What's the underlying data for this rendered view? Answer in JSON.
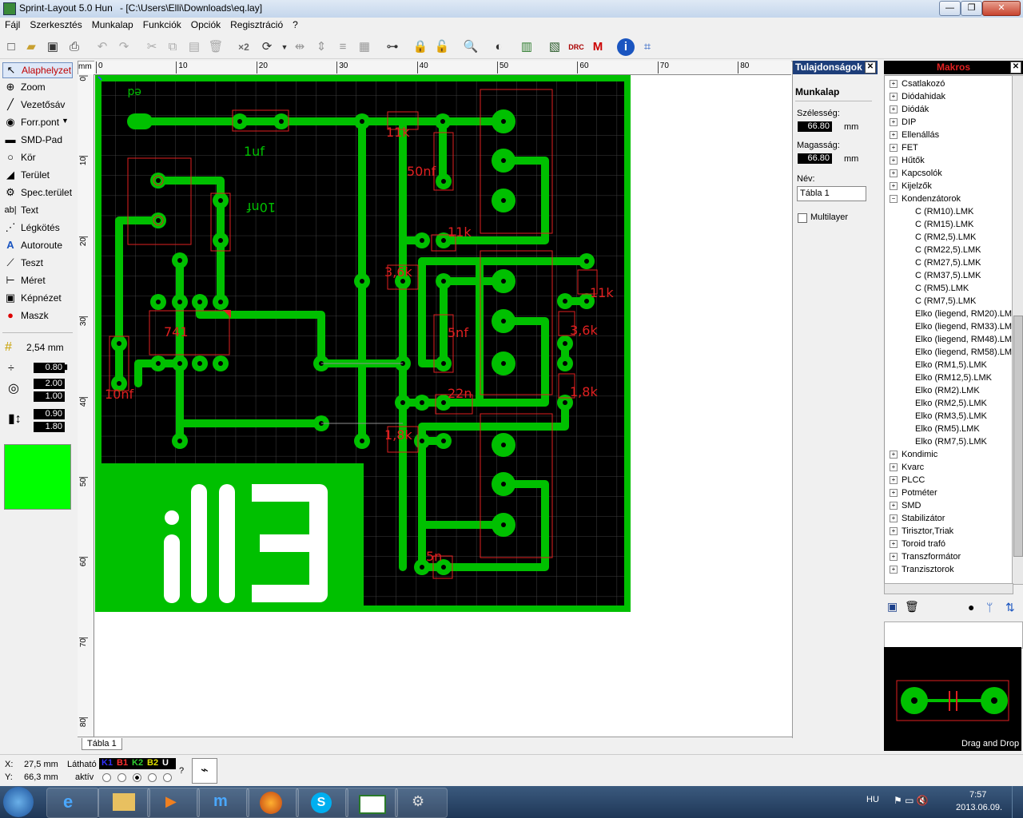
{
  "window": {
    "app_title": "Sprint-Layout 5.0 Hun",
    "file_path": "- [C:\\Users\\Elli\\Downloads\\eq.lay]",
    "minimize": "—",
    "restore": "❐",
    "close": "✕"
  },
  "menu": [
    "Fájl",
    "Szerkesztés",
    "Munkalap",
    "Funkciók",
    "Opciók",
    "Regisztráció",
    "?"
  ],
  "toolbar": {
    "x2_label": "×2"
  },
  "tools": [
    {
      "label": "Alaphelyzet",
      "icon": "pointer-icon"
    },
    {
      "label": "Zoom",
      "icon": "zoom-icon"
    },
    {
      "label": "Vezetősáv",
      "icon": "track-icon"
    },
    {
      "label": "Forr.pont",
      "icon": "pad-icon"
    },
    {
      "label": "SMD-Pad",
      "icon": "smd-pad-icon"
    },
    {
      "label": "Kör",
      "icon": "circle-icon"
    },
    {
      "label": "Terület",
      "icon": "zone-icon"
    },
    {
      "label": "Spec.terület",
      "icon": "special-zone-icon"
    },
    {
      "label": "Text",
      "icon": "text-icon"
    },
    {
      "label": "Légkötés",
      "icon": "airwire-icon"
    },
    {
      "label": "Autoroute",
      "icon": "autoroute-icon"
    },
    {
      "label": "Teszt",
      "icon": "test-icon"
    },
    {
      "label": "Méret",
      "icon": "measure-icon"
    },
    {
      "label": "Képnézet",
      "icon": "photoview-icon"
    },
    {
      "label": "Maszk",
      "icon": "mask-icon"
    }
  ],
  "grid": {
    "label": "2,54 mm"
  },
  "settings": {
    "track_width": "0.80",
    "pad_outer": "2.00",
    "pad_inner": "1.00",
    "smd_w": "0.90",
    "smd_h": "1.80"
  },
  "colors": {
    "active_layer": "#00ff00",
    "board": "#000000",
    "copper": "#00cc00",
    "component": "#ff2020"
  },
  "ruler": {
    "top_unit": "mm",
    "top": [
      "0",
      "10",
      "20",
      "30",
      "40",
      "50",
      "60",
      "70",
      "80"
    ],
    "left": [
      "0",
      "10",
      "20",
      "30",
      "40",
      "50",
      "60",
      "70",
      "80"
    ]
  },
  "board": {
    "labels": [
      "ed",
      "1uf",
      "10nf",
      "741",
      "10nf",
      "11k",
      "50nf",
      "11k",
      "3,6k",
      "5nf",
      "22n",
      "1,8k",
      "5n",
      "11k",
      "3,6k",
      "1,8k"
    ],
    "logo": "ill3"
  },
  "sheet_tab": "Tábla 1",
  "properties": {
    "header": "Tulajdonságok",
    "section": "Munkalap",
    "width_label": "Szélesség:",
    "width_value": "66.80",
    "height_label": "Magasság:",
    "height_value": "66.80",
    "unit": "mm",
    "name_label": "Név:",
    "name_value": "Tábla 1",
    "multilayer": "Multilayer"
  },
  "macros": {
    "header": "Makros",
    "items": [
      {
        "label": "Csatlakozó",
        "level": 0
      },
      {
        "label": "Diódahidak",
        "level": 0
      },
      {
        "label": "Diódák",
        "level": 0
      },
      {
        "label": "DIP",
        "level": 0
      },
      {
        "label": "Ellenállás",
        "level": 0
      },
      {
        "label": "FET",
        "level": 0
      },
      {
        "label": "Hűtők",
        "level": 0
      },
      {
        "label": "Kapcsolók",
        "level": 0
      },
      {
        "label": "Kijelzők",
        "level": 0
      },
      {
        "label": "Kondenzátorok",
        "level": 0,
        "open": true
      },
      {
        "label": "C (RM10).LMK",
        "level": 1
      },
      {
        "label": "C (RM15).LMK",
        "level": 1
      },
      {
        "label": "C (RM2,5).LMK",
        "level": 1
      },
      {
        "label": "C (RM22,5).LMK",
        "level": 1
      },
      {
        "label": "C (RM27,5).LMK",
        "level": 1
      },
      {
        "label": "C (RM37,5).LMK",
        "level": 1
      },
      {
        "label": "C (RM5).LMK",
        "level": 1
      },
      {
        "label": "C (RM7,5).LMK",
        "level": 1
      },
      {
        "label": "Elko (liegend, RM20).LM",
        "level": 1
      },
      {
        "label": "Elko (liegend, RM33).LM",
        "level": 1
      },
      {
        "label": "Elko (liegend, RM48).LM",
        "level": 1
      },
      {
        "label": "Elko (liegend, RM58).LM",
        "level": 1
      },
      {
        "label": "Elko (RM1,5).LMK",
        "level": 1
      },
      {
        "label": "Elko (RM12,5).LMK",
        "level": 1
      },
      {
        "label": "Elko (RM2).LMK",
        "level": 1
      },
      {
        "label": "Elko (RM2,5).LMK",
        "level": 1
      },
      {
        "label": "Elko (RM3,5).LMK",
        "level": 1
      },
      {
        "label": "Elko (RM5).LMK",
        "level": 1
      },
      {
        "label": "Elko (RM7,5).LMK",
        "level": 1
      },
      {
        "label": "Kondimic",
        "level": 0
      },
      {
        "label": "Kvarc",
        "level": 0
      },
      {
        "label": "PLCC",
        "level": 0
      },
      {
        "label": "Potméter",
        "level": 0
      },
      {
        "label": "SMD",
        "level": 0
      },
      {
        "label": "Stabilizátor",
        "level": 0
      },
      {
        "label": "Tirisztor,Triak",
        "level": 0
      },
      {
        "label": "Toroid trafó",
        "level": 0
      },
      {
        "label": "Transzformátor",
        "level": 0
      },
      {
        "label": "Tranzisztorok",
        "level": 0
      }
    ],
    "drag_drop": "Drag and Drop"
  },
  "status": {
    "x_label": "X:",
    "x_value": "27,5 mm",
    "y_label": "Y:",
    "y_value": "66,3 mm",
    "visible_label": "Látható",
    "active_label": "aktív",
    "layers": [
      {
        "name": "K1",
        "color": "#3030ff"
      },
      {
        "name": "B1",
        "color": "#ff3030"
      },
      {
        "name": "K2",
        "color": "#30d030"
      },
      {
        "name": "B2",
        "color": "#e0e000"
      },
      {
        "name": "U",
        "color": "#ffffff"
      }
    ],
    "help": "?"
  },
  "taskbar": {
    "lang": "HU",
    "time": "7:57",
    "date": "2013.06.09."
  }
}
